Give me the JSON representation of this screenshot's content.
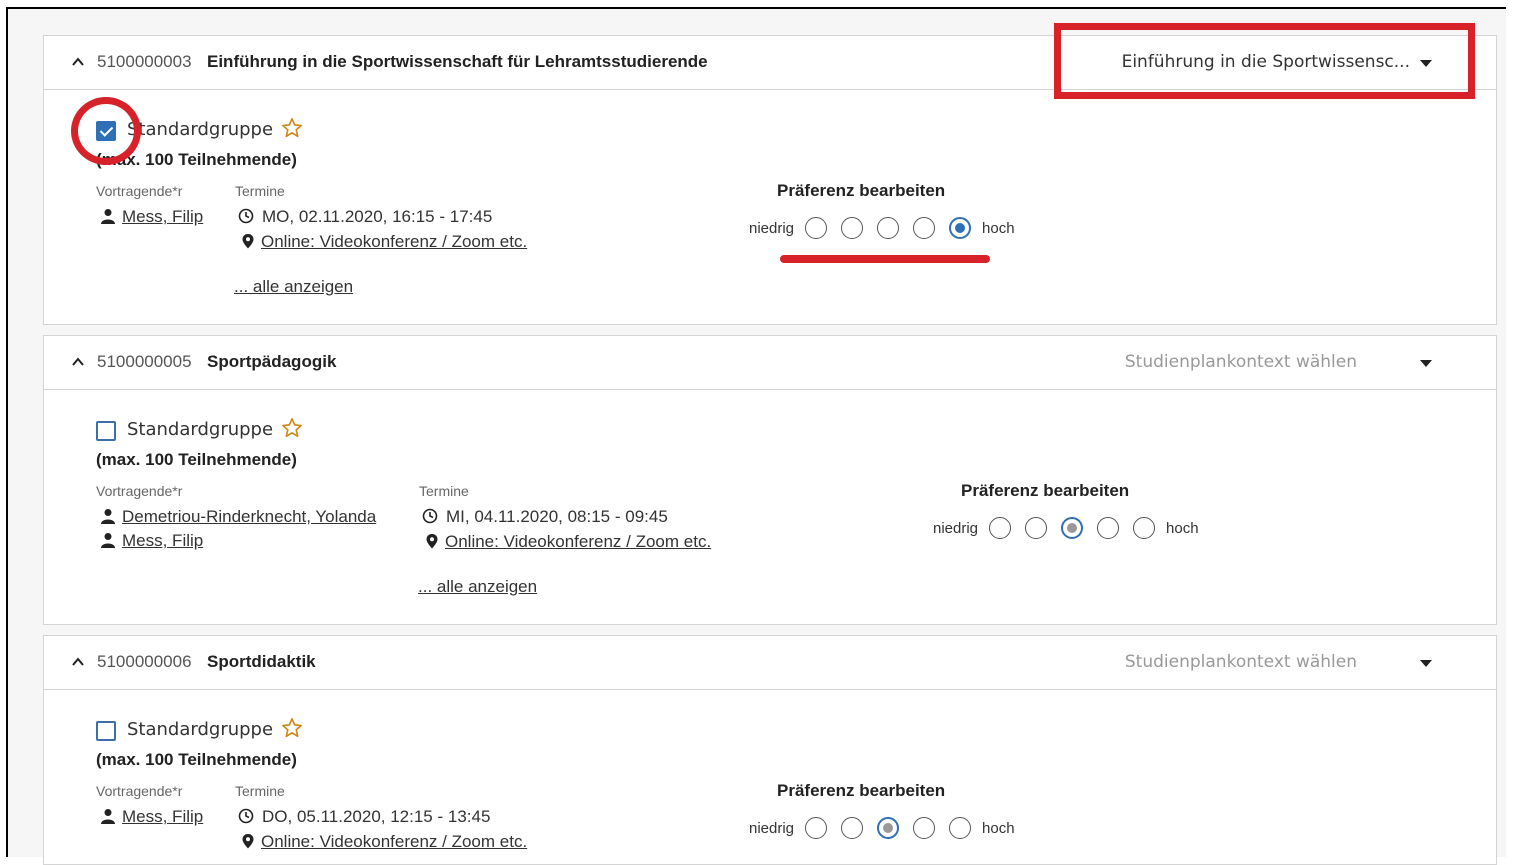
{
  "common": {
    "group_name": "Standardgruppe",
    "group_capacity": "(max. 100 Teilnehmende)",
    "label_speakers": "Vortragende*r",
    "label_dates": "Termine",
    "show_all": "... alle anzeigen",
    "pref_title": "Präferenz bearbeiten",
    "pref_low": "niedrig",
    "pref_high": "hoch"
  },
  "courses": [
    {
      "id": "5100000003",
      "title": "Einführung in die Sportwissenschaft für Lehramtsstudierende",
      "context": "Einführung in die Sportwissensc...",
      "checked": true,
      "speakers": [
        "Mess, Filip"
      ],
      "date": "MO, 02.11.2020, 16:15 - 17:45",
      "location": "Online: Videokonferenz / Zoom etc.",
      "preference": 5
    },
    {
      "id": "5100000005",
      "title": "Sportpädagogik",
      "context": "Studienplankontext wählen",
      "checked": false,
      "speakers": [
        "Demetriou-Rinderknecht, Yolanda",
        "Mess, Filip"
      ],
      "date": "MI, 04.11.2020, 08:15 - 09:45",
      "location": "Online: Videokonferenz / Zoom etc.",
      "preference": 3
    },
    {
      "id": "5100000006",
      "title": "Sportdidaktik",
      "context": "Studienplankontext wählen",
      "checked": false,
      "speakers": [
        "Mess, Filip"
      ],
      "date": "DO, 05.11.2020, 12:15 - 13:45",
      "location": "Online: Videokonferenz / Zoom etc.",
      "preference": 3
    }
  ],
  "colors": {
    "annotation_red": "#d8222a",
    "checkbox_blue": "#2f6fb5"
  }
}
